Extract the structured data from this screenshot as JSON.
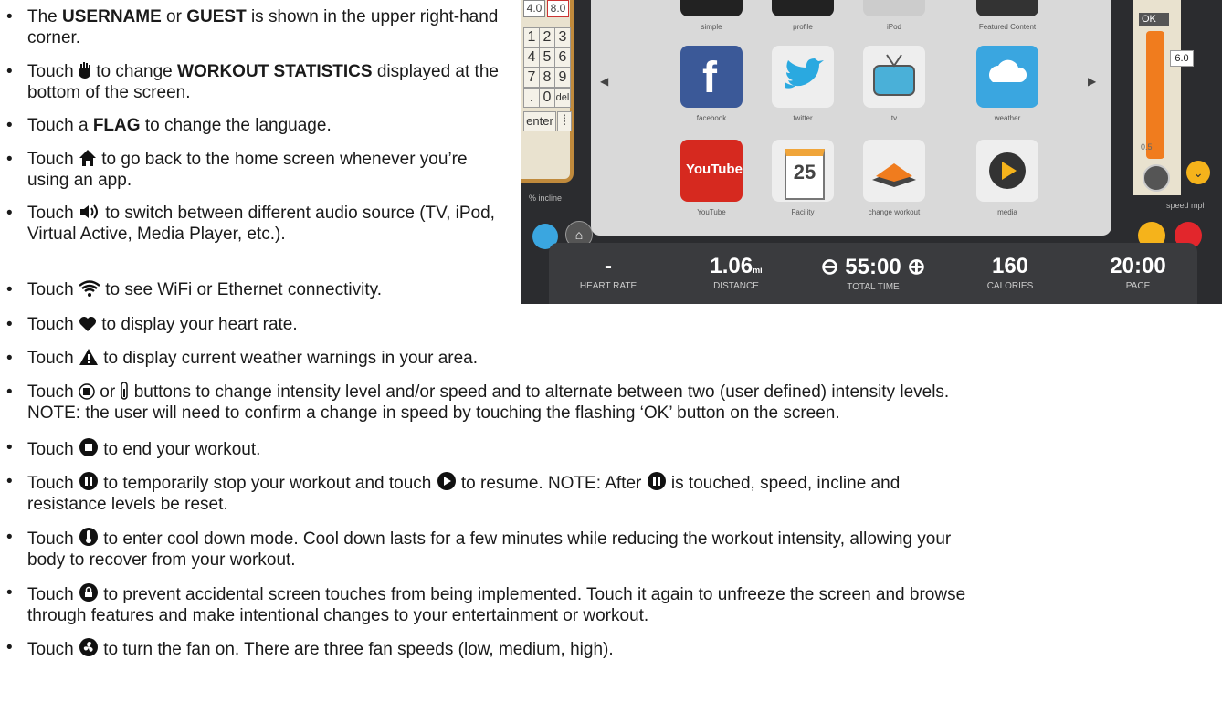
{
  "bullets": [
    {
      "pre": "The ",
      "b1": "USERNAME",
      "mid": " or ",
      "b2": "GUEST",
      "post": " is shown in the upper right-hand corner."
    },
    {
      "pre": "Touch ",
      "icon": "hand-icon",
      "mid": " to change ",
      "b1": "WORKOUT STATISTICS",
      "post": " displayed at the bottom of the screen."
    },
    {
      "pre": "Touch a ",
      "b1": "FLAG",
      "post": " to change the language."
    },
    {
      "pre": "Touch ",
      "icon": "home-icon",
      "post": " to go back to the home screen whenever you’re using an app."
    },
    {
      "pre": "Touch ",
      "icon": "speaker-icon",
      "post": " to switch between different audio source (TV, iPod, Virtual Active, Media Player, etc.)."
    },
    {
      "pre": "Touch ",
      "icon": "wifi-icon",
      "post": " to see WiFi or Ethernet connectivity."
    },
    {
      "pre": "Touch ",
      "icon": "heart-icon",
      "post": " to display your heart rate."
    },
    {
      "pre": "Touch ",
      "icon": "warning-icon",
      "post": " to display current weather warnings in your area."
    },
    {
      "pre": "Touch ",
      "icon": "keypad-icon",
      "mid": " or ",
      "icon2": "slider-icon",
      "post": " buttons to change intensity level and/or speed and to alternate between two (user defined) intensity levels.",
      "line2": "NOTE: the user will need to confirm a change in speed by touching the flashing ‘OK’ button on the screen."
    },
    {
      "pre": "Touch ",
      "icon": "stop-icon",
      "post": " to end your workout."
    },
    {
      "pre": "Touch ",
      "icon": "pause-icon",
      "mid": " to temporarily stop your workout and touch ",
      "icon2": "play-icon",
      "mid2": " to resume. NOTE: After ",
      "icon3": "pause-icon",
      "post": " is touched, speed, incline and",
      "line2": "resistance levels be reset."
    },
    {
      "pre": "Touch ",
      "icon": "thermometer-icon",
      "post": " to enter cool down mode. Cool down lasts for a few minutes while reducing the workout intensity, allowing your",
      "line2": "body to recover from your workout."
    },
    {
      "pre": "Touch ",
      "icon": "lock-icon",
      "post": " to prevent accidental screen touches from being implemented. Touch it again to unfreeze the screen and browse",
      "line2": "through features and make intentional changes to your entertainment or workout."
    },
    {
      "pre": "Touch ",
      "icon": "fan-icon",
      "post": " to turn the fan on. There are three fan speeds (low, medium, high)."
    }
  ],
  "screen": {
    "keypad_values": [
      "4.0",
      "8.0"
    ],
    "keypad_keys": [
      "1",
      "2",
      "3",
      "4",
      "5",
      "6",
      "7",
      "8",
      "9",
      ".",
      "0",
      "del"
    ],
    "enter_label": "enter",
    "incline_label": "% incline",
    "apps_row1": [
      "simple",
      "profile",
      "iPod",
      "Featured Content"
    ],
    "apps_row2": [
      "facebook",
      "twitter",
      "tv",
      "weather"
    ],
    "apps_row3": [
      "YouTube",
      "Facility",
      "change workout",
      "media"
    ],
    "youtube_logo": "YouTube",
    "calendar_day": "25",
    "ok_label": "OK",
    "speed_value": "6.0",
    "speed_low": "0.5",
    "speed_label": "speed mph",
    "stats": [
      {
        "value": "-",
        "unit": "",
        "label": "HEART RATE"
      },
      {
        "value": "1.06",
        "unit": "mi",
        "label": "DISTANCE"
      },
      {
        "value": "55:00",
        "unit": "",
        "label": "TOTAL TIME"
      },
      {
        "value": "160",
        "unit": "",
        "label": "CALORIES"
      },
      {
        "value": "20:00",
        "unit": "",
        "label": "PACE"
      }
    ]
  },
  "colors": {
    "accent_orange": "#f07c1e",
    "red": "#e2262c",
    "yellow": "#f5b31b",
    "fan_blue": "#3aa6e0"
  }
}
